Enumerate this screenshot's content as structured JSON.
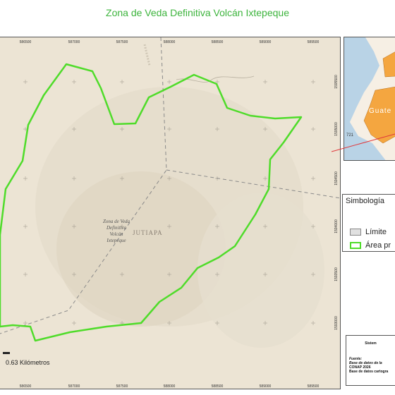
{
  "title": "Zona de Veda Definitiva Volcán Ixtepeque",
  "map": {
    "x_ticks": [
      "586500",
      "587000",
      "587500",
      "588000",
      "588500",
      "589000",
      "589500"
    ],
    "x_ticks_bottom": [
      "586500",
      "587000",
      "587500",
      "588000",
      "588500",
      "589000",
      "589500"
    ],
    "y_ticks": [
      "1595500",
      "1595000",
      "1594500",
      "1594000",
      "1593500",
      "1593000"
    ],
    "area_label": [
      "Zona de Veda",
      "Definitiva",
      "Volcán",
      "Ixtepeque"
    ],
    "department_label": "JUTIAPA",
    "scale_label": "0.63 Kilómetros",
    "colors": {
      "background": "#ece4d4",
      "protected_area_outline": "#4fdc2a",
      "boundary_dash": "#8a8a8a"
    }
  },
  "inset": {
    "country_label": "Guate",
    "number_label": "721",
    "colors": {
      "sea": "#b9d3e6",
      "land": "#f4a640",
      "highlight": "#e8a030"
    }
  },
  "legend": {
    "title": "Simbología",
    "items": [
      {
        "label": "Límite",
        "swatch": "#e0e0e0",
        "border": "#888888"
      },
      {
        "label": "Área pr",
        "swatch": "#ffffff",
        "border": "#4fdc2a"
      }
    ]
  },
  "credits": {
    "heading": "Sistem",
    "lines": [
      "Fuente:",
      "Base de datos de la",
      "CONAP 2026",
      "Base de datos cartogra"
    ]
  }
}
